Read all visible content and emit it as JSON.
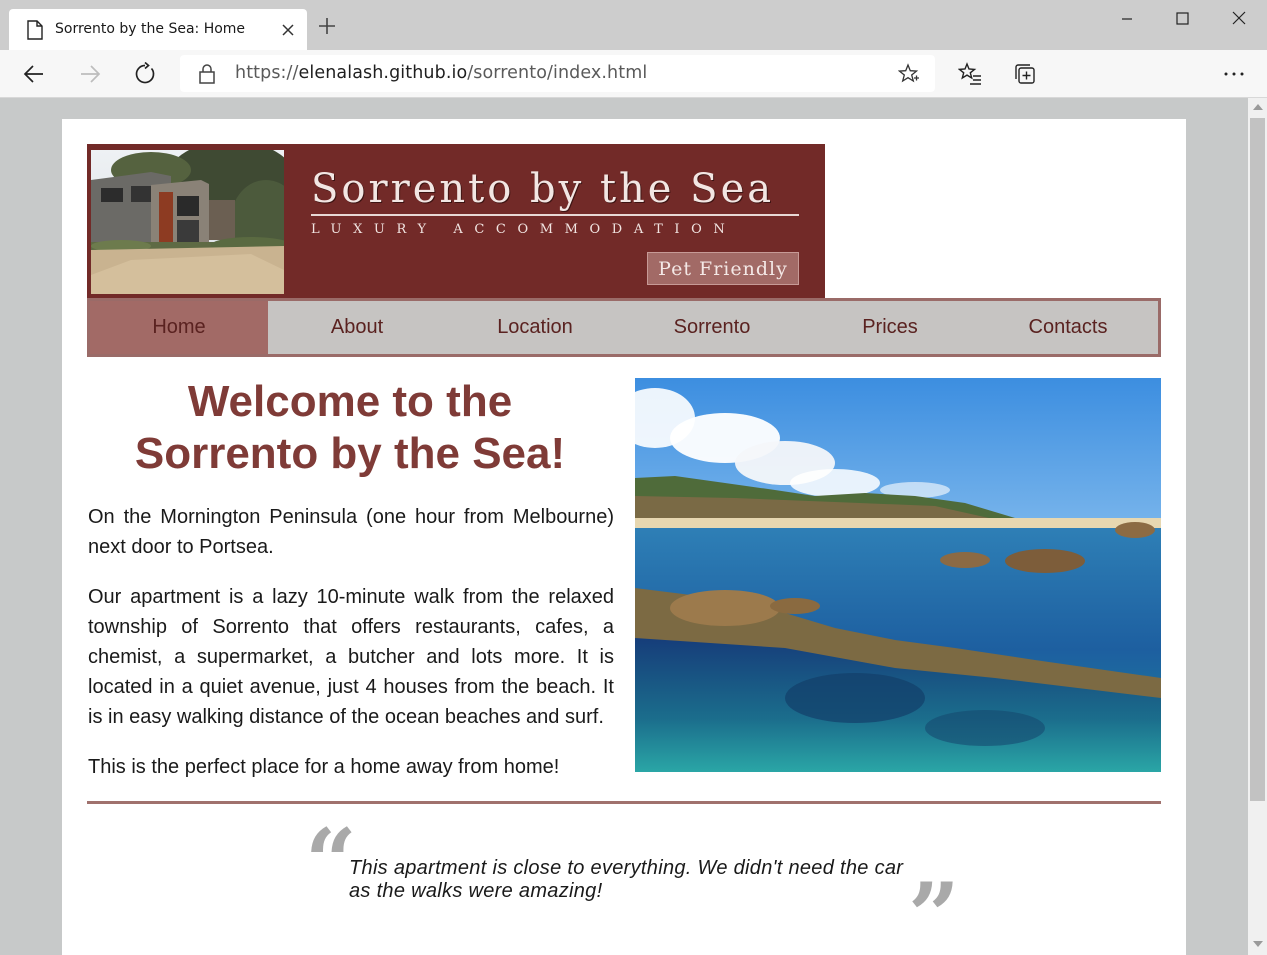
{
  "browser": {
    "tab_title": "Sorrento by the Sea: Home",
    "url_prefix": "https://",
    "url_host": "elenalash.github.io",
    "url_path": "/sorrento/index.html",
    "icons": {
      "tab_page": "page-icon",
      "tab_close": "close-icon",
      "new_tab": "plus-icon",
      "minimize": "minimize-icon",
      "maximize": "maximize-icon",
      "close_window": "close-icon",
      "back": "arrow-left-icon",
      "forward": "arrow-right-icon",
      "refresh": "refresh-icon",
      "lock": "lock-icon",
      "favorite": "star-icon",
      "favorites_list": "favorites-icon",
      "collections": "collections-icon",
      "more": "more-icon"
    }
  },
  "header": {
    "site_title": "Sorrento by the Sea",
    "subtitle": "LUXURY ACCOMMODATION",
    "badge": "Pet Friendly"
  },
  "nav": {
    "items": [
      "Home",
      "About",
      "Location",
      "Sorrento",
      "Prices",
      "Contacts"
    ],
    "active": "Home"
  },
  "main": {
    "heading_line1": "Welcome to the",
    "heading_line2": "Sorrento by the Sea!",
    "paragraph1": "On the Mornington Peninsula (one hour from Melbourne) next door to Portsea.",
    "paragraph2": "Our apartment is a lazy 10-minute walk from the relaxed township of Sorrento that offers restaurants, cafes, a chemist, a supermarket, a butcher and lots more. It is located in a quiet avenue, just 4 houses from the beach. It is in easy walking distance of the ocean beaches and surf.",
    "paragraph3": "This is the perfect place for a home away from home!"
  },
  "testimonial": {
    "quote_open": "“",
    "quote_close": "”",
    "text": "This apartment is close to everything. We didn't need the car as the walks were amazing!"
  },
  "colors": {
    "banner": "#722a28",
    "nav_active": "#a26a66",
    "nav_bg": "#c6c4c2",
    "heading": "#7f3b37",
    "divider": "#a0716d"
  }
}
